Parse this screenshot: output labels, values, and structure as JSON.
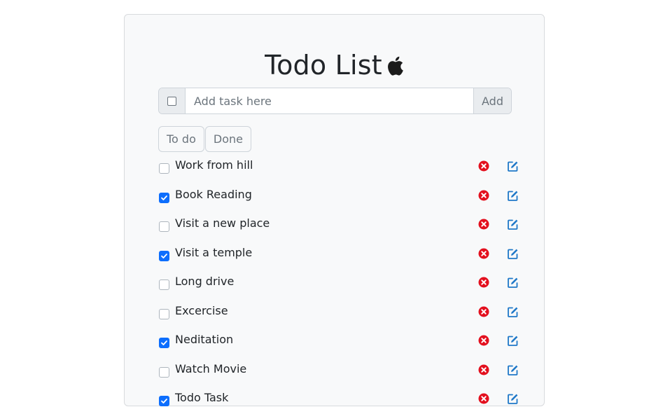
{
  "app": {
    "title": "Todo List",
    "title_icon": "apple-icon"
  },
  "new_task": {
    "placeholder": "Add task here",
    "value": "",
    "select_all_checked": false,
    "add_label": "Add"
  },
  "tabs": [
    {
      "label": "To do"
    },
    {
      "label": "Done"
    }
  ],
  "tasks": [
    {
      "label": "Work from hill",
      "done": false
    },
    {
      "label": "Book Reading",
      "done": true
    },
    {
      "label": "Visit a new place",
      "done": false
    },
    {
      "label": "Visit a temple",
      "done": true
    },
    {
      "label": "Long drive",
      "done": false
    },
    {
      "label": "Excercise",
      "done": false
    },
    {
      "label": "Neditation",
      "done": true
    },
    {
      "label": "Watch Movie",
      "done": false
    },
    {
      "label": "Todo Task",
      "done": true
    }
  ],
  "icons": {
    "delete": "close-circle-icon",
    "edit": "edit-icon"
  },
  "colors": {
    "accent": "#0d6efd",
    "delete": "#e3101e",
    "edit": "#1f78c8",
    "card_bg": "#f8f9fa"
  }
}
